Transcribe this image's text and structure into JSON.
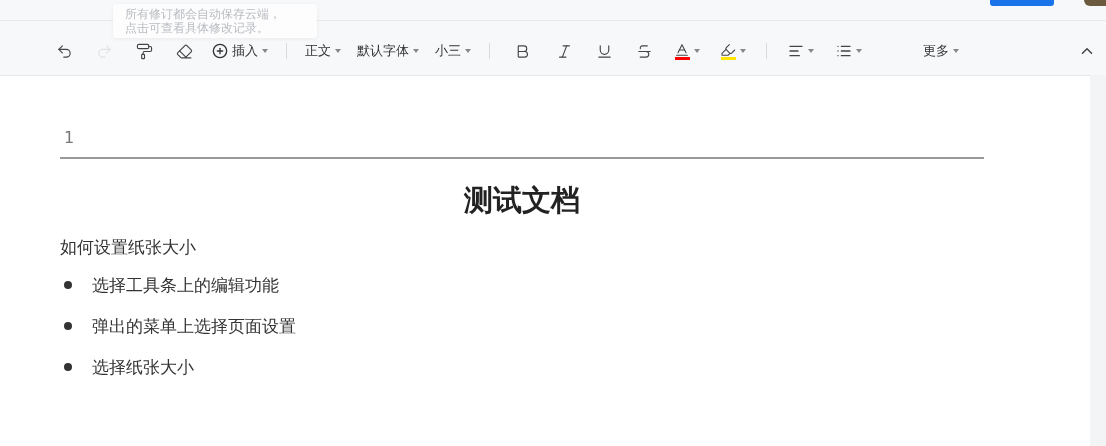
{
  "tooltip": {
    "lines": [
      "所有修订都会自动保存云端，",
      "点击可查看具体修改记录。"
    ]
  },
  "toolbar": {
    "items": [
      {
        "kind": "undo",
        "disabled": false
      },
      {
        "kind": "redo",
        "disabled": true
      },
      {
        "kind": "painter",
        "disabled": false
      },
      {
        "kind": "eraser",
        "disabled": false
      },
      {
        "kind": "insert",
        "label": "插入"
      },
      {
        "kind": "separator"
      },
      {
        "kind": "dropdown",
        "label": "正文"
      },
      {
        "kind": "dropdown",
        "label": "默认字体"
      },
      {
        "kind": "dropdown",
        "label": "小三"
      },
      {
        "kind": "separator"
      },
      {
        "kind": "bold",
        "disabled": false
      },
      {
        "kind": "italic",
        "disabled": false
      },
      {
        "kind": "underline",
        "disabled": false
      },
      {
        "kind": "strike",
        "disabled": false
      },
      {
        "kind": "font-color",
        "color": "#ff0000"
      },
      {
        "kind": "highlight",
        "color": "#ffe600"
      },
      {
        "kind": "separator"
      },
      {
        "kind": "align"
      },
      {
        "kind": "list"
      },
      {
        "kind": "more",
        "label": "更多"
      }
    ]
  },
  "document": {
    "header": "1",
    "title": "测试文档",
    "paragraphs": [
      {
        "kind": "para",
        "text": "如何设置纸张大小"
      },
      {
        "kind": "bullet",
        "text": "选择工具条上的编辑功能"
      },
      {
        "kind": "bullet",
        "text": "弹出的菜单上选择页面设置"
      },
      {
        "kind": "bullet",
        "text": "选择纸张大小"
      }
    ]
  }
}
